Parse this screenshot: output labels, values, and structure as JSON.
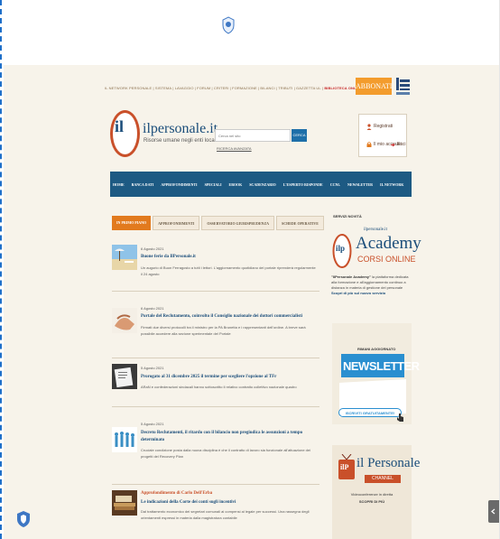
{
  "top_ad": {
    "links": [
      "IL NETWORK PERSONALE",
      "SISTEMA",
      "LAVAGGIO",
      "FORUM",
      "CRITERI",
      "FORMAZIONE",
      "BILANCI",
      "TRIBUTI",
      "GAZZETTA UL"
    ],
    "brand": "BIBLIOTECA ONLINE.it"
  },
  "abbonati_label": "ABBONATI",
  "logo": {
    "mark": "il",
    "name": "ilpersonale.it",
    "tagline": "Risorse umane negli enti locali"
  },
  "search": {
    "placeholder": "Cerca nel sito",
    "button": "CERCA",
    "advanced": "RICERCA AVANZATA"
  },
  "login": {
    "register": "Registrati",
    "login": "Il mio account",
    "exit": "Esci"
  },
  "nav": [
    "HOME",
    "BANCA DATI",
    "APPROFONDIMENTI",
    "SPECIALI",
    "EBOOK",
    "SCADENZARIO",
    "L'ESPERTO RISPONDE",
    "CCNL",
    "NEWSLETTER",
    "IL NETWORK"
  ],
  "tabs": [
    "IN PRIMO PIANO",
    "APPROFONDIMENTI",
    "OSSERVATORIO GIURISPRUDENZA",
    "SCHEDE OPERATIVE"
  ],
  "news": [
    {
      "date": "6 Agosto 2021",
      "title": "Buone ferie da IlPersonale.it",
      "excerpt": "Un augurio di Buon Ferragosto a tutti i lettori. L'aggiornamento quotidiano del portale riprenderà regolarmente il 24 agosto"
    },
    {
      "date": "6 Agosto 2021",
      "title": "Portale del Reclutamento, coinvolto il Consiglio nazionale dei dottori commercialisti",
      "excerpt": "Firmati due diversi protocolli tra il ministro per la PA Brunetta e i rappresentanti dell'ordine. A breve sarà possibile accedere alla sezione sperimentale del Portale"
    },
    {
      "date": "5 Agosto 2021",
      "title": "Prorogato al 31 dicembre 2025 il termine per scegliere l'opzione al TFr",
      "excerpt": "ARaN e confederazioni sindacali hanno sottoscritto il relativo contratto collettivo nazionale quadro"
    },
    {
      "date": "5 Agosto 2021",
      "title": "Decreto Reclutamenti, il ritardo con il bilancio non pregiudica le assunzioni a tempo determinato",
      "excerpt": "Cruciale condizione posta dalla nuova disciplina è che il contratto di lavoro sia funzionale all'attuazione dei progetti del Recovery Plan"
    },
    {
      "kicker": "Approfondimento di Carlo Dell'Erba",
      "title": "Le indicazioni della Corte dei conti sugli incentivi",
      "excerpt": "Dal trattamento economico dei segretari comunali ai compensi al legale per successi. Una rassegna degli orientamenti espressi in materia dalla magistratura contabile"
    }
  ],
  "sidebar": {
    "title": "SERVIZI NOVITÀ",
    "academy": {
      "top": "ilpersonale.it",
      "mark": "ilp",
      "name": "Academy",
      "sub": "CORSI ONLINE",
      "desc_bold": "\"IlPersonale Academy\"",
      "desc": "la piattaforma dedicata alla formazione e all'aggiornamento continuo a distanza in materia di gestione del personale",
      "link": "Scopri di più sul nuovo servizio"
    },
    "newsletter": {
      "kicker": "RIMANI AGGIORNATO",
      "title": "NEWSLETTER",
      "button": "ISCRIVITI GRATUITAMENTE!"
    },
    "channel": {
      "mark": "ilP",
      "name": "il Personale",
      "ribbon": "CHANNEL",
      "line1": "Videoconferenze in diretta",
      "line2": "SCOPRI DI PIÙ"
    }
  },
  "colors": {
    "accent": "#e27a1e",
    "brand_blue": "#1d5a83",
    "logo_red": "#c9502a",
    "page_bg": "#f7f3ea"
  }
}
